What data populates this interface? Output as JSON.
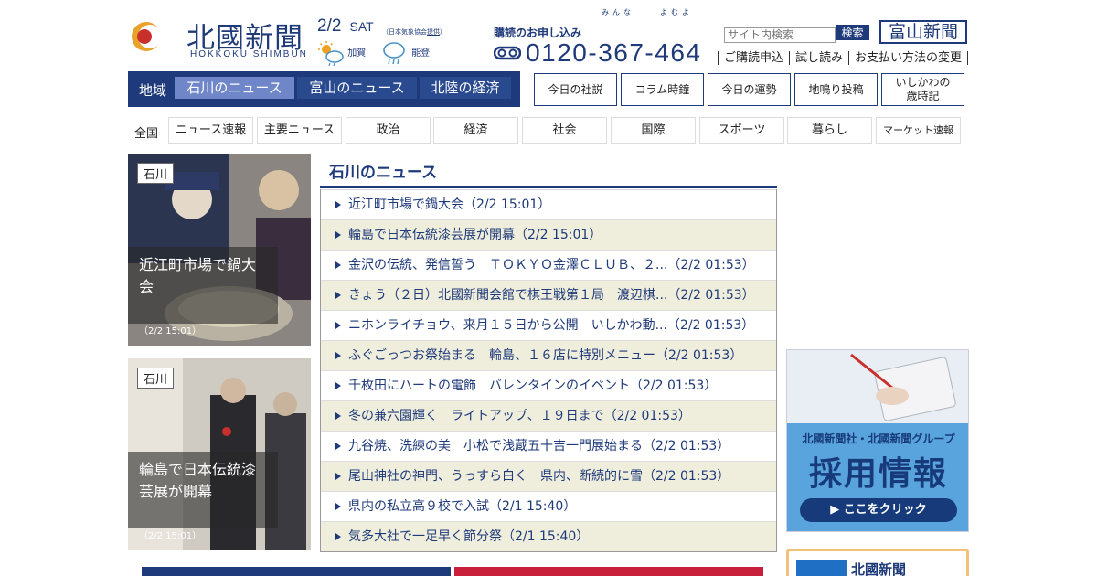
{
  "header": {
    "logo_name": "北國新聞",
    "logo_sub": "HOKKOKU SHIMBUN",
    "date": "2/2",
    "day": "SAT",
    "weather_note_prefix": "（日本気象協会",
    "weather_note_link": "提供",
    "weather_note_suffix": "）",
    "weather_kaga": "加賀",
    "weather_noto": "能登",
    "subscribe_label": "購読のお申し込み",
    "ruby_1": "みんな",
    "ruby_2": "よむよ",
    "phone": "0120-367-464",
    "search_placeholder": "サイト内検索",
    "search_button": "検索",
    "toyama_button": "富山新聞",
    "links": [
      "ご購読申込",
      "試し読み",
      "お支払い方法の変更"
    ]
  },
  "region": {
    "label": "地域",
    "tabs": [
      "石川のニュース",
      "富山のニュース",
      "北陸の経済"
    ]
  },
  "features": [
    "今日の社説",
    "コラム時鐘",
    "今日の運勢",
    "地鳴り投稿",
    "いしかわの\n歳時記"
  ],
  "categories": {
    "all": "全国",
    "items": [
      "ニュース速報",
      "主要ニュース",
      "政治",
      "経済",
      "社会",
      "国際",
      "スポーツ",
      "暮らし",
      "マーケット速報"
    ]
  },
  "photos": [
    {
      "tag": "石川",
      "caption": "近江町市場で鍋大会",
      "time": "（2/2 15:01）"
    },
    {
      "tag": "石川",
      "caption": "輪島で日本伝統漆芸展が開幕",
      "time": "（2/2 15:01）"
    }
  ],
  "news": {
    "heading": "石川のニュース",
    "items": [
      "近江町市場で鍋大会（2/2 15:01）",
      "輪島で日本伝統漆芸展が開幕（2/2 15:01）",
      "金沢の伝統、発信誓う　ＴＯＫＹＯ金澤ＣＬＵＢ、２...（2/2 01:53）",
      "きょう（２日）北國新聞会館で棋王戦第１局　渡辺棋...（2/2 01:53）",
      "ニホンライチョウ、来月１５日から公開　いしかわ動...（2/2 01:53）",
      "ふぐごっつお祭始まる　輪島、１６店に特別メニュー（2/2 01:53）",
      "千枚田にハートの電飾　バレンタインのイベント（2/2 01:53）",
      "冬の兼六園輝く　ライトアップ、１９日まで（2/2 01:53）",
      "九谷焼、洗練の美　小松で浅蔵五十吉一門展始まる（2/2 01:53）",
      "尾山神社の神門、うっすら白く　県内、断続的に雪（2/2 01:53）",
      "県内の私立高９校で入試（2/1 15:40）",
      "気多大社で一足早く節分祭（2/1 15:40）"
    ]
  },
  "ad": {
    "line1": "北國新聞社・北國新聞グループ",
    "line2": "採用情報",
    "button": "▶ ここをクリック"
  },
  "promo": {
    "title": "北國新聞"
  },
  "colors": {
    "brand": "#1f3a7a",
    "region_active": "#6f86c9",
    "stripe": "#efeedd"
  }
}
